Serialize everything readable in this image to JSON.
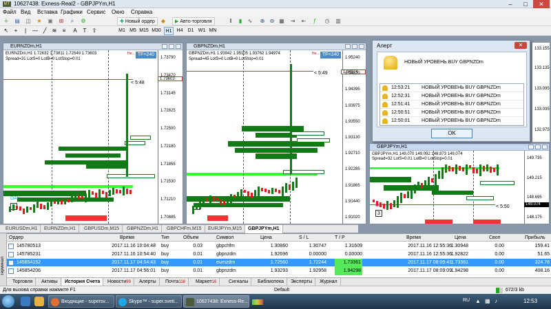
{
  "window": {
    "title": "10627438: Exness-Real2 - GBPJPYm,H1",
    "min": "–",
    "max": "□",
    "close": "✕"
  },
  "menu": [
    "Файл",
    "Вид",
    "Вставка",
    "Графики",
    "Сервис",
    "Окно",
    "Справка"
  ],
  "toolbar": {
    "new_order": "Новый ордер",
    "autotrade": "Авто-торговля",
    "timeframes": [
      "M1",
      "M5",
      "M15",
      "M30",
      "H1",
      "H4",
      "D1",
      "W1",
      "MN"
    ],
    "active_tf": "H1"
  },
  "charts": {
    "eurnzd": {
      "title": "EURNZDm,H1",
      "info1": "EURNZDm,H1  1.72632 1.73811 1.72549 1.73603",
      "info2": "Spread=31  LotS=0  LotB=0  LotStop=0.01",
      "timer": "< 5:48",
      "tf": "TF=240",
      "hl": "Не...",
      "day": "DAY",
      "n": "3",
      "price_tag": "1.73603",
      "axis": [
        "1.73790",
        "1.73470",
        "1.73145",
        "1.72825",
        "1.72500",
        "1.72180",
        "1.71855",
        "1.71530",
        "1.71210",
        "1.70885"
      ]
    },
    "gbpnzd": {
      "title": "GBPNZDm,H1",
      "info1": "GBPNZDm,H1  1.93942 1.95105 1.93762 1.94974",
      "info2": "Spread=45  LotS=0  LotB=0  LotStop=0.01",
      "timer": "< 5:49",
      "tf": "TF=240",
      "hl": "Не...",
      "n": "3",
      "price_tag": "1.94974",
      "axis": [
        "1.95240",
        "1.94820",
        "1.94395",
        "1.93975",
        "1.93550",
        "1.93130",
        "1.92710",
        "1.92285",
        "1.91865",
        "1.91440",
        "1.91020"
      ]
    },
    "gbpjpy": {
      "title": "GBPJPYm,H1",
      "info1": "GBPJPYm,H1  149.070 149.092 148.873 149.074",
      "info2": "Spread=32  LotS=0.01  LotB=0  LotStop=0.01",
      "timer": "< 5:50",
      "day": "DAY",
      "n": "3",
      "price_tag": "149.074",
      "axis": [
        "149.735",
        "149.215",
        "148.695",
        "148.175"
      ]
    }
  },
  "alert": {
    "title": "Алерт",
    "main_msg": "НОВЫЙ УРОВЕНЬ BUY GBPNZDm",
    "ok": "OK",
    "rows": [
      {
        "t": "12:53:21",
        "m": "НОВЫЙ УРОВЕНЬ BUY GBPNZDm"
      },
      {
        "t": "12:52:31",
        "m": "НОВЫЙ УРОВЕНЬ BUY GBPNZDm"
      },
      {
        "t": "12:51:41",
        "m": "НОВЫЙ УРОВЕНЬ BUY GBPNZDm"
      },
      {
        "t": "12:50:51",
        "m": "НОВЫЙ УРОВЕНЬ BUY GBPNZDm"
      },
      {
        "t": "12:50:01",
        "m": "НОВЫЙ УРОВЕНЬ BUY GBPNZDm"
      }
    ],
    "axis": [
      "133.155",
      "133.135",
      "133.095",
      "133.035",
      "132.975"
    ]
  },
  "chart_tabs": [
    "EURUSDm,H1",
    "EURNZDm,H1",
    "GBPUSDm,M15",
    "GBPNZDm,H1",
    "GBPCHFm,M15",
    "EURJPYm,M15",
    "GBPJPYm,H1"
  ],
  "active_chart_tab": "GBPJPYm,H1",
  "terminal": {
    "side": "Терминал",
    "headers": [
      "Ордер",
      "Время",
      "Тип",
      "Объем",
      "Символ",
      "Цена",
      "S / L",
      "T / P",
      "Время",
      "Цена",
      "Своп",
      "Прибыль"
    ],
    "rows": [
      [
        "145780513",
        "2017.11.16 10:04:48",
        "buy",
        "0.03",
        "gbpchfm",
        "1.30860",
        "1.30747",
        "1.31609",
        "2017.11.16 12:55:36",
        "1.30948",
        "0.00",
        "159.41"
      ],
      [
        "145785231",
        "2017.11.16 10:54:40",
        "buy",
        "0.01",
        "gbpnzdm",
        "1.92696",
        "0.00000",
        "0.00000",
        "2017.11.16 12:55:36",
        "1.92822",
        "0.00",
        "51.65"
      ],
      [
        "145854152",
        "2017.11.17 04:54:43",
        "buy",
        "0.01",
        "eurnzdm",
        "1.72560",
        "1.72244",
        "1.73361",
        "2017.11.17 08:09:41",
        "1.73361",
        "0.00",
        "324.78"
      ],
      [
        "145854206",
        "2017.11.17 04:56:01",
        "buy",
        "0.01",
        "gbpnzdm",
        "1.93293",
        "1.92958",
        "1.94298",
        "2017.11.17 08:09:09",
        "1.94298",
        "0.00",
        "408.16"
      ]
    ],
    "tabs": [
      {
        "l": "Торговля",
        "n": ""
      },
      {
        "l": "Активы",
        "n": ""
      },
      {
        "l": "История Счета",
        "n": ""
      },
      {
        "l": "Новости",
        "n": "99"
      },
      {
        "l": "Алерты",
        "n": ""
      },
      {
        "l": "Почта",
        "n": "118"
      },
      {
        "l": "Маркет",
        "n": "16"
      },
      {
        "l": "Сигналы",
        "n": ""
      },
      {
        "l": "Библиотека",
        "n": ""
      },
      {
        "l": "Эксперты",
        "n": ""
      },
      {
        "l": "Журнал",
        "n": ""
      }
    ],
    "active_tab": "История Счета"
  },
  "status": {
    "help": "Для вызова справки нажмите F1",
    "profile": "Default",
    "traffic": "672/3 kb"
  },
  "taskbar": {
    "items": [
      "Входящие - supersv...",
      "Skype™ - super.sveti...",
      "10627438: Exness-Re..."
    ],
    "lang": "RU",
    "clock": "12:53"
  },
  "colors": {
    "bull": "#117a17",
    "bear": "#e01b1b",
    "alert_line": "#33ff33",
    "sl": "#cc0000"
  }
}
